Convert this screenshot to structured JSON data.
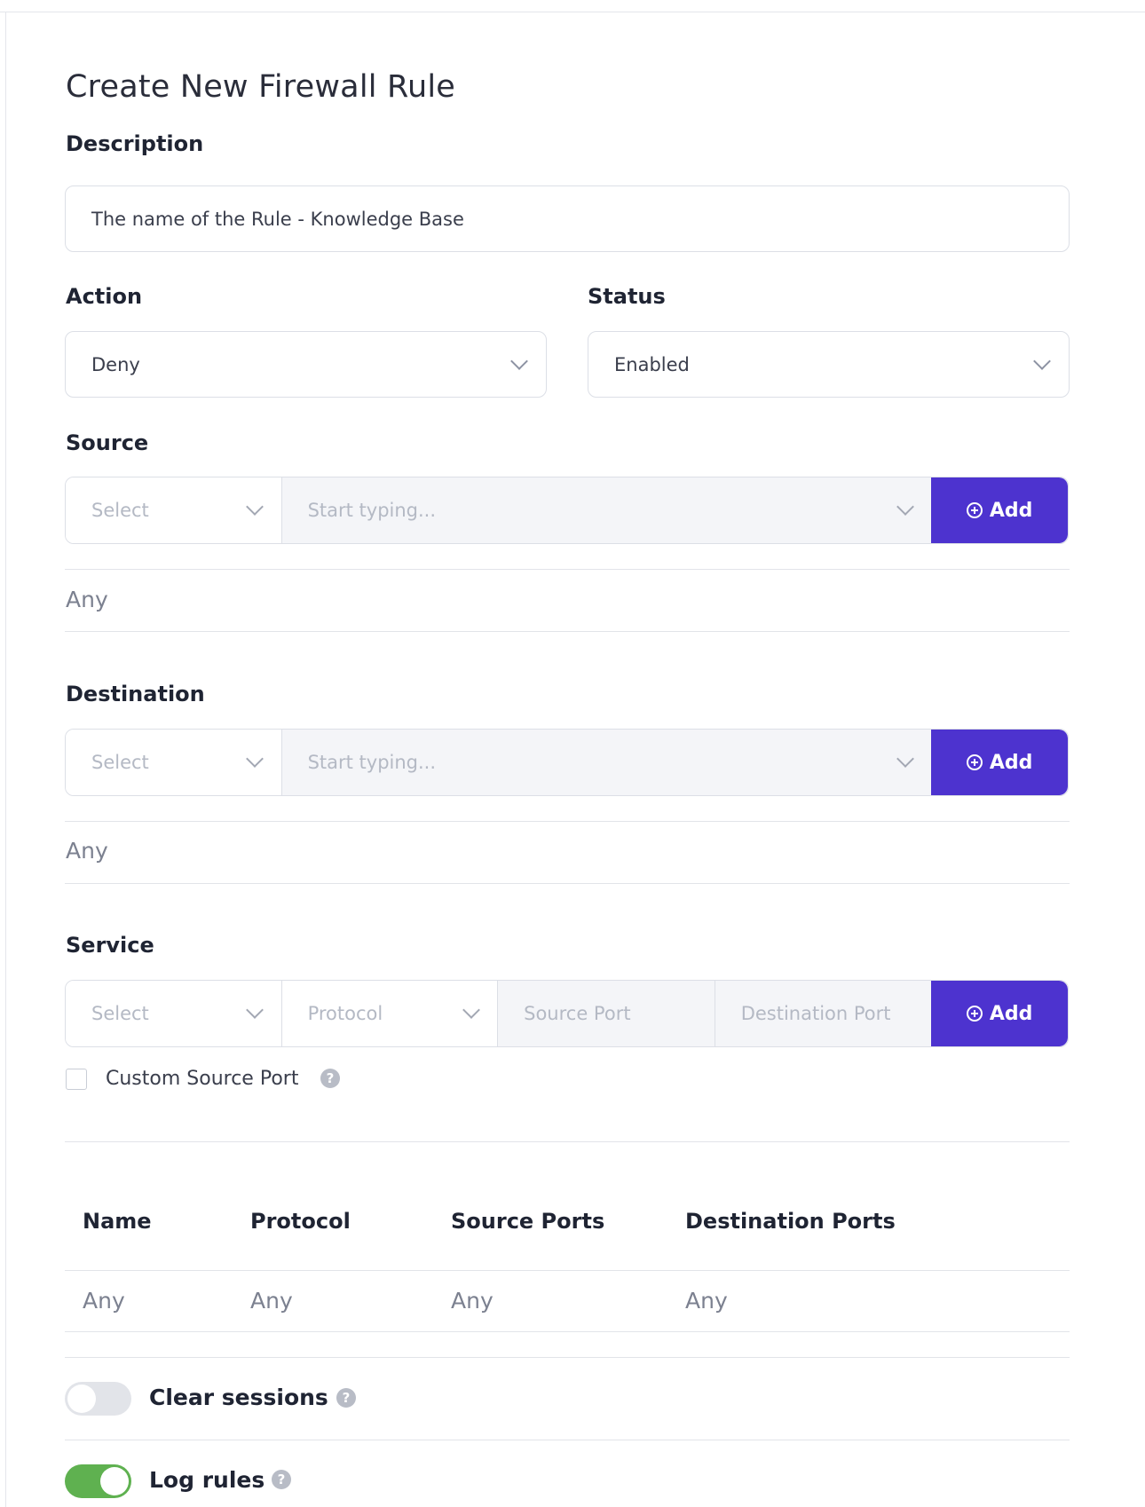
{
  "page": {
    "title": "Create New Firewall Rule"
  },
  "description": {
    "label": "Description",
    "value": "The name of the Rule - Knowledge Base"
  },
  "action": {
    "label": "Action",
    "value": "Deny"
  },
  "status": {
    "label": "Status",
    "value": "Enabled"
  },
  "source": {
    "label": "Source",
    "type_placeholder": "Select",
    "search_placeholder": "Start typing...",
    "add_label": "Add",
    "value": "Any"
  },
  "destination": {
    "label": "Destination",
    "type_placeholder": "Select",
    "search_placeholder": "Start typing...",
    "add_label": "Add",
    "value": "Any"
  },
  "service": {
    "label": "Service",
    "select_placeholder": "Select",
    "protocol_placeholder": "Protocol",
    "source_port_placeholder": "Source Port",
    "destination_port_placeholder": "Destination Port",
    "add_label": "Add",
    "custom_source_port": {
      "label": "Custom Source Port",
      "checked": false
    }
  },
  "service_table": {
    "columns": [
      "Name",
      "Protocol",
      "Source Ports",
      "Destination Ports"
    ],
    "rows": [
      [
        "Any",
        "Any",
        "Any",
        "Any"
      ]
    ]
  },
  "clear_sessions": {
    "label": "Clear sessions",
    "enabled": false
  },
  "log_rules": {
    "label": "Log rules",
    "enabled": true
  },
  "colors": {
    "accent": "#4d33cf",
    "toggle_on": "#5fb150",
    "toggle_off": "#e2e4e9"
  },
  "help_glyph": "?"
}
